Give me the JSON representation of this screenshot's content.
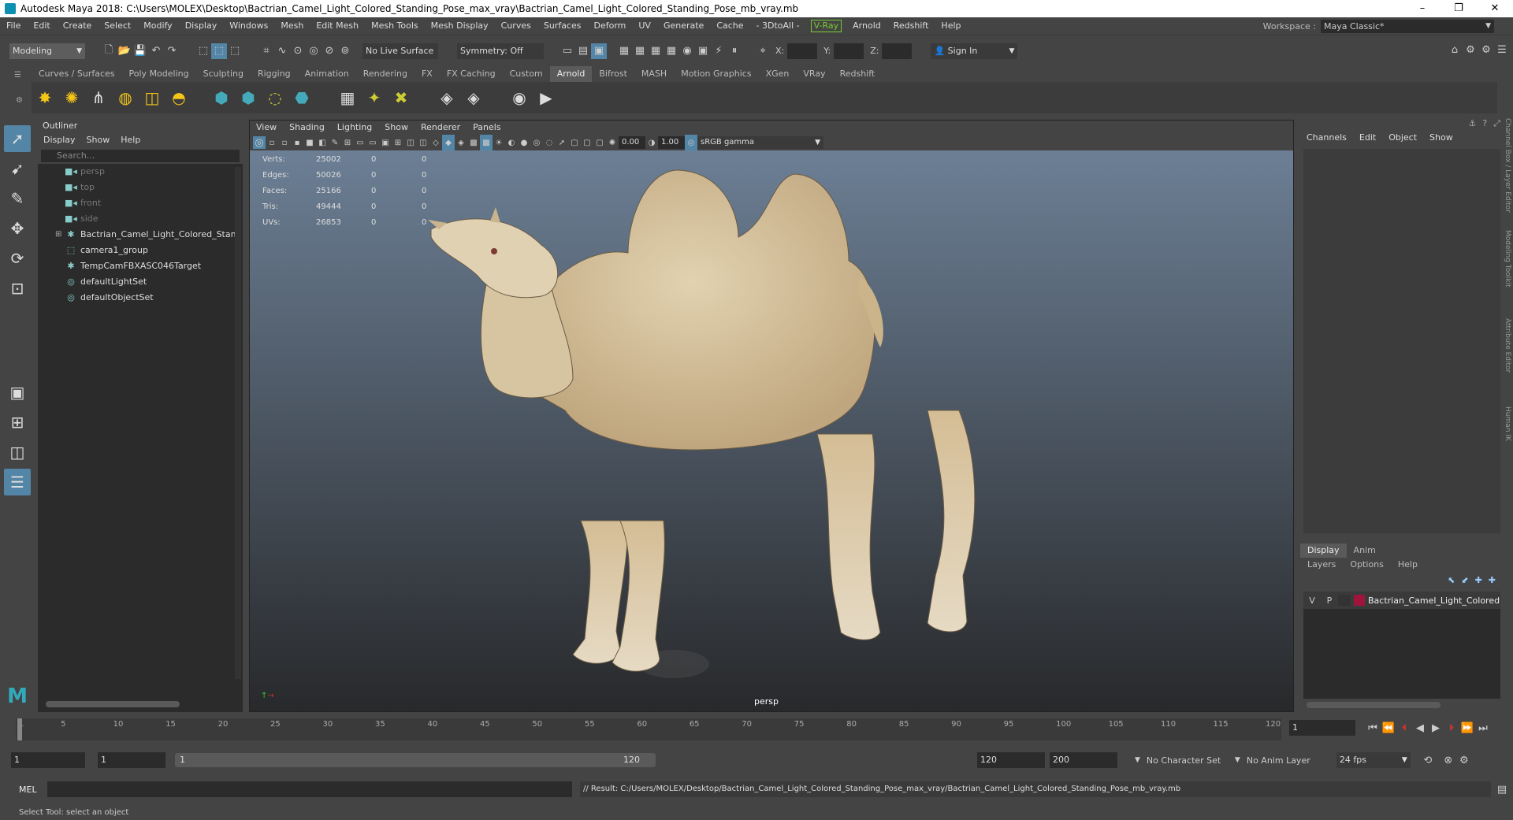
{
  "titlebar": {
    "title": "Autodesk Maya 2018: C:\\Users\\MOLEX\\Desktop\\Bactrian_Camel_Light_Colored_Standing_Pose_max_vray\\Bactrian_Camel_Light_Colored_Standing_Pose_mb_vray.mb"
  },
  "menu": [
    "File",
    "Edit",
    "Create",
    "Select",
    "Modify",
    "Display",
    "Windows",
    "Mesh",
    "Edit Mesh",
    "Mesh Tools",
    "Mesh Display",
    "Curves",
    "Surfaces",
    "Deform",
    "UV",
    "Generate",
    "Cache",
    "- 3DtoAll -",
    "V-Ray",
    "Arnold",
    "Redshift",
    "Help"
  ],
  "workspace": {
    "label": "Workspace :",
    "value": "Maya Classic*"
  },
  "status": {
    "mode": "Modeling",
    "live_surface": "No Live Surface",
    "symmetry": "Symmetry: Off",
    "x_label": "X:",
    "y_label": "Y:",
    "z_label": "Z:",
    "sign_in": "Sign In"
  },
  "shelf_tabs": [
    "Curves / Surfaces",
    "Poly Modeling",
    "Sculpting",
    "Rigging",
    "Animation",
    "Rendering",
    "FX",
    "FX Caching",
    "Custom",
    "Arnold",
    "Bifrost",
    "MASH",
    "Motion Graphics",
    "XGen",
    "VRay",
    "Redshift"
  ],
  "shelf_active": "Arnold",
  "outliner": {
    "title": "Outliner",
    "menu": [
      "Display",
      "Show",
      "Help"
    ],
    "search_placeholder": "Search...",
    "items": [
      {
        "label": "persp",
        "dim": true
      },
      {
        "label": "top",
        "dim": true
      },
      {
        "label": "front",
        "dim": true
      },
      {
        "label": "side",
        "dim": true
      },
      {
        "label": "Bactrian_Camel_Light_Colored_Stand",
        "dim": false
      },
      {
        "label": "camera1_group",
        "dim": false
      },
      {
        "label": "TempCamFBXASC046Target",
        "dim": false
      },
      {
        "label": "defaultLightSet",
        "dim": false
      },
      {
        "label": "defaultObjectSet",
        "dim": false
      }
    ]
  },
  "viewport": {
    "menu": [
      "View",
      "Shading",
      "Lighting",
      "Show",
      "Renderer",
      "Panels"
    ],
    "exposure": "0.00",
    "gamma": "1.00",
    "color_space": "sRGB gamma",
    "camera": "persp",
    "hud": [
      {
        "label": "Verts:",
        "a": "25002",
        "b": "0",
        "c": "0"
      },
      {
        "label": "Edges:",
        "a": "50026",
        "b": "0",
        "c": "0"
      },
      {
        "label": "Faces:",
        "a": "25166",
        "b": "0",
        "c": "0"
      },
      {
        "label": "Tris:",
        "a": "49444",
        "b": "0",
        "c": "0"
      },
      {
        "label": "UVs:",
        "a": "26853",
        "b": "0",
        "c": "0"
      }
    ]
  },
  "channelbox": {
    "menu": [
      "Channels",
      "Edit",
      "Object",
      "Show"
    ]
  },
  "layers": {
    "tabs": [
      "Display",
      "Anim"
    ],
    "menu": [
      "Layers",
      "Options",
      "Help"
    ],
    "layer": {
      "v": "V",
      "p": "P",
      "name": "Bactrian_Camel_Light_Colored",
      "color": "#a0143c"
    }
  },
  "side_tabs": [
    "Channel Box / Layer Editor",
    "Modeling Toolkit",
    "Attribute Editor",
    "Human IK"
  ],
  "timeline": {
    "ticks": [
      "1",
      "5",
      "10",
      "15",
      "20",
      "25",
      "30",
      "35",
      "40",
      "45",
      "50",
      "55",
      "60",
      "65",
      "70",
      "75",
      "80",
      "85",
      "90",
      "95",
      "100",
      "105",
      "110",
      "115",
      "120"
    ],
    "current_frame": "1"
  },
  "range": {
    "start": "1",
    "inner_start": "1",
    "slider_start": "1",
    "slider_end": "120",
    "end": "120",
    "outer_end": "200",
    "char_set": "No Character Set",
    "anim_layer": "No Anim Layer",
    "fps": "24 fps"
  },
  "command": {
    "lang": "MEL",
    "result": "// Result: C:/Users/MOLEX/Desktop/Bactrian_Camel_Light_Colored_Standing_Pose_max_vray/Bactrian_Camel_Light_Colored_Standing_Pose_mb_vray.mb"
  },
  "help_line": "Select Tool: select an object",
  "colors": {
    "accent": "#5285a6",
    "vray": "#77cc33",
    "layer": "#a0143c"
  }
}
